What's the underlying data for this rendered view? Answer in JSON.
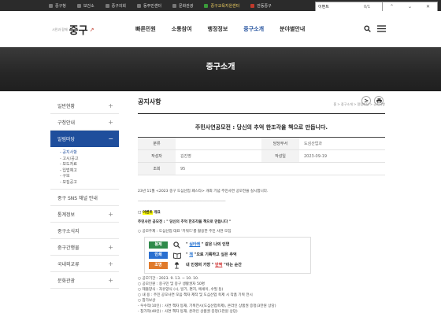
{
  "topbar": {
    "links": [
      "중구청",
      "보건소",
      "중구의회",
      "동주민센터",
      "문화관광",
      "중구교육지원센터",
      "안동중구"
    ]
  },
  "findbar": {
    "query": "이벤트",
    "count": "0/1"
  },
  "header": {
    "logo_small": "시민과 함께",
    "logo_big": "중구",
    "logo_mark": "↗",
    "nav": [
      "빠른민원",
      "소통참여",
      "행정정보",
      "중구소개",
      "분야별안내"
    ],
    "active_index": 3
  },
  "banner": {
    "title": "중구소개"
  },
  "sidebar": {
    "items": [
      {
        "label": "일반현황",
        "pm": "+"
      },
      {
        "label": "구청안내",
        "pm": "+"
      },
      {
        "label": "알림마당",
        "pm": "−"
      }
    ],
    "subitems": [
      "공지사항",
      "고시/공고",
      "보도자료",
      "입법예고",
      "구보",
      "모집공고"
    ],
    "active_sub": 0,
    "items_after": [
      {
        "label": "중구 SNS 채널 안내",
        "pm": ""
      },
      {
        "label": "통계정보",
        "pm": "+"
      },
      {
        "label": "중구소식지",
        "pm": ""
      },
      {
        "label": "중구간행물",
        "pm": "+"
      },
      {
        "label": "국내외교류",
        "pm": "+"
      },
      {
        "label": "문화관광",
        "pm": "+"
      }
    ]
  },
  "content": {
    "page_title": "공지사항",
    "breadcrumb": "홈 > 중구소개 > 알림마당 > 공지사항",
    "post_title": "주민사연공모전 : 당신의 추억 한조각을 책으로 만듭니다.",
    "meta": {
      "category_label": "분류",
      "category_value": "",
      "dept_label": "담당부서",
      "dept_value": "도심산업과",
      "author_label": "작성자",
      "author_value": "김진명",
      "date_label": "작성일",
      "date_value": "2023-09-19",
      "views_label": "조회",
      "views_value": "95"
    },
    "body": {
      "intro": "23년 11월 <2023 중구 도심산업 페스타> 개최 기념 주민사연 공모전을 실시합니다.",
      "dashes": "------------------------------------------------------------------------------------------------",
      "sec_prefix": "□ ",
      "sec_hl": "이벤트",
      "sec_suffix": " 개요",
      "theme": "주민사연 공모전 : \" 당신의 추억 한조각을 책으로 만듭니다 \"",
      "subject": "○ 공모주제 : 도심산업 대표 '키워드'를 활용한 주민 사연 모집",
      "box": [
        {
          "tag": "봉제",
          "color": "#2f8a4a",
          "pre": "\" ",
          "kw": "실타래",
          "kwcolor": "blue",
          "post": " \" 같은 나의 인연",
          "icon": "search-icon"
        },
        {
          "tag": "인쇄",
          "color": "#2a6fd0",
          "pre": "\" ",
          "kw": "책",
          "kwcolor": "blue",
          "post": " \"으로 기록하고 싶은 추억",
          "icon": "book-icon"
        },
        {
          "tag": "조명",
          "color": "#e07a2a",
          "pre": "내 인생의 가장 \" ",
          "kw": "반짝",
          "kwcolor": "red",
          "post": " \"이는 순간",
          "icon": "lamp-icon"
        }
      ],
      "lines": [
        "○ 공모기간 : 2023. 9. 13. ~ 10. 10.",
        "○ 공모인원 : 중구민 및 중구 생활권자 50명",
        "○ 제출양식 : 자유양식 (시, 일기, 편지, 에세이, 수필 등)",
        "○ 내  용 : 주민 공모사연 모음 책자 제작 및 도심산업 축제 시 작품 기획 전시",
        "○ 참가보상",
        " - 우수작(10인) : 사연 책자 등재, 기획전시(도심산업축제), 온라인 상품권 증정(3만원 상당)",
        " - 참가작(40인) : 사연 책자 등재, 온라인 상품권 증정(1만원 상당)"
      ]
    }
  },
  "colors": {
    "accent": "#1f4e9c",
    "topbar": "#2b2b2b",
    "highlight": "#ffff00"
  }
}
